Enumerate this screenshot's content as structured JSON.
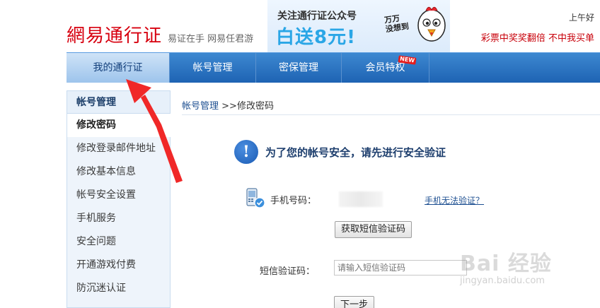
{
  "header": {
    "logo_brand": "網易",
    "logo_product": "通行证",
    "slogan": "易证在手 网易任君游",
    "greeting": "上午好",
    "promo": "彩票中奖奖翻倍 不中我买单",
    "banner": {
      "top": "关注通行证公众号",
      "main": "白送8元!",
      "side": "万万\n没想到"
    }
  },
  "nav": {
    "items": [
      {
        "label": "我的通行证",
        "active": true
      },
      {
        "label": "帐号管理",
        "active": false
      },
      {
        "label": "密保管理",
        "active": false
      },
      {
        "label": "会员特权",
        "active": false,
        "badge": "NEW"
      }
    ]
  },
  "sidebar": {
    "title": "帐号管理",
    "items": [
      {
        "label": "修改密码",
        "active": true
      },
      {
        "label": "修改登录邮件地址"
      },
      {
        "label": "修改基本信息"
      },
      {
        "label": "帐号安全设置"
      },
      {
        "label": "手机服务"
      },
      {
        "label": "安全问题"
      },
      {
        "label": "开通游戏付费"
      },
      {
        "label": "防沉迷认证"
      }
    ]
  },
  "main": {
    "breadcrumb_link": "帐号管理",
    "breadcrumb_current": ">>修改密码",
    "notice": "为了您的帐号安全，请先进行安全验证",
    "phone_label": "手机号码：",
    "phone_help": "手机无法验证？",
    "get_code_button": "获取短信验证码",
    "sms_label": "短信验证码：",
    "sms_placeholder": "请输入短信验证码",
    "next_button": "下一步"
  },
  "watermark": {
    "logo": "Bai 经验",
    "url": "jingyan.baidu.com"
  },
  "colors": {
    "brand_red": "#d7000f",
    "nav_blue": "#1e63b3",
    "annotation_red": "#f02828"
  }
}
